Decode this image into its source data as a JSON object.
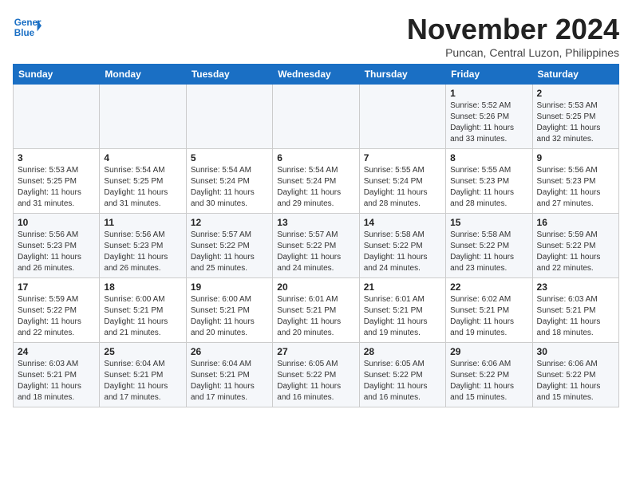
{
  "header": {
    "logo_general": "General",
    "logo_blue": "Blue",
    "month": "November 2024",
    "location": "Puncan, Central Luzon, Philippines"
  },
  "weekdays": [
    "Sunday",
    "Monday",
    "Tuesday",
    "Wednesday",
    "Thursday",
    "Friday",
    "Saturday"
  ],
  "weeks": [
    [
      {
        "day": "",
        "sunrise": "",
        "sunset": "",
        "daylight": ""
      },
      {
        "day": "",
        "sunrise": "",
        "sunset": "",
        "daylight": ""
      },
      {
        "day": "",
        "sunrise": "",
        "sunset": "",
        "daylight": ""
      },
      {
        "day": "",
        "sunrise": "",
        "sunset": "",
        "daylight": ""
      },
      {
        "day": "",
        "sunrise": "",
        "sunset": "",
        "daylight": ""
      },
      {
        "day": "1",
        "sunrise": "Sunrise: 5:52 AM",
        "sunset": "Sunset: 5:26 PM",
        "daylight": "Daylight: 11 hours and 33 minutes."
      },
      {
        "day": "2",
        "sunrise": "Sunrise: 5:53 AM",
        "sunset": "Sunset: 5:25 PM",
        "daylight": "Daylight: 11 hours and 32 minutes."
      }
    ],
    [
      {
        "day": "3",
        "sunrise": "Sunrise: 5:53 AM",
        "sunset": "Sunset: 5:25 PM",
        "daylight": "Daylight: 11 hours and 31 minutes."
      },
      {
        "day": "4",
        "sunrise": "Sunrise: 5:54 AM",
        "sunset": "Sunset: 5:25 PM",
        "daylight": "Daylight: 11 hours and 31 minutes."
      },
      {
        "day": "5",
        "sunrise": "Sunrise: 5:54 AM",
        "sunset": "Sunset: 5:24 PM",
        "daylight": "Daylight: 11 hours and 30 minutes."
      },
      {
        "day": "6",
        "sunrise": "Sunrise: 5:54 AM",
        "sunset": "Sunset: 5:24 PM",
        "daylight": "Daylight: 11 hours and 29 minutes."
      },
      {
        "day": "7",
        "sunrise": "Sunrise: 5:55 AM",
        "sunset": "Sunset: 5:24 PM",
        "daylight": "Daylight: 11 hours and 28 minutes."
      },
      {
        "day": "8",
        "sunrise": "Sunrise: 5:55 AM",
        "sunset": "Sunset: 5:23 PM",
        "daylight": "Daylight: 11 hours and 28 minutes."
      },
      {
        "day": "9",
        "sunrise": "Sunrise: 5:56 AM",
        "sunset": "Sunset: 5:23 PM",
        "daylight": "Daylight: 11 hours and 27 minutes."
      }
    ],
    [
      {
        "day": "10",
        "sunrise": "Sunrise: 5:56 AM",
        "sunset": "Sunset: 5:23 PM",
        "daylight": "Daylight: 11 hours and 26 minutes."
      },
      {
        "day": "11",
        "sunrise": "Sunrise: 5:56 AM",
        "sunset": "Sunset: 5:23 PM",
        "daylight": "Daylight: 11 hours and 26 minutes."
      },
      {
        "day": "12",
        "sunrise": "Sunrise: 5:57 AM",
        "sunset": "Sunset: 5:22 PM",
        "daylight": "Daylight: 11 hours and 25 minutes."
      },
      {
        "day": "13",
        "sunrise": "Sunrise: 5:57 AM",
        "sunset": "Sunset: 5:22 PM",
        "daylight": "Daylight: 11 hours and 24 minutes."
      },
      {
        "day": "14",
        "sunrise": "Sunrise: 5:58 AM",
        "sunset": "Sunset: 5:22 PM",
        "daylight": "Daylight: 11 hours and 24 minutes."
      },
      {
        "day": "15",
        "sunrise": "Sunrise: 5:58 AM",
        "sunset": "Sunset: 5:22 PM",
        "daylight": "Daylight: 11 hours and 23 minutes."
      },
      {
        "day": "16",
        "sunrise": "Sunrise: 5:59 AM",
        "sunset": "Sunset: 5:22 PM",
        "daylight": "Daylight: 11 hours and 22 minutes."
      }
    ],
    [
      {
        "day": "17",
        "sunrise": "Sunrise: 5:59 AM",
        "sunset": "Sunset: 5:22 PM",
        "daylight": "Daylight: 11 hours and 22 minutes."
      },
      {
        "day": "18",
        "sunrise": "Sunrise: 6:00 AM",
        "sunset": "Sunset: 5:21 PM",
        "daylight": "Daylight: 11 hours and 21 minutes."
      },
      {
        "day": "19",
        "sunrise": "Sunrise: 6:00 AM",
        "sunset": "Sunset: 5:21 PM",
        "daylight": "Daylight: 11 hours and 20 minutes."
      },
      {
        "day": "20",
        "sunrise": "Sunrise: 6:01 AM",
        "sunset": "Sunset: 5:21 PM",
        "daylight": "Daylight: 11 hours and 20 minutes."
      },
      {
        "day": "21",
        "sunrise": "Sunrise: 6:01 AM",
        "sunset": "Sunset: 5:21 PM",
        "daylight": "Daylight: 11 hours and 19 minutes."
      },
      {
        "day": "22",
        "sunrise": "Sunrise: 6:02 AM",
        "sunset": "Sunset: 5:21 PM",
        "daylight": "Daylight: 11 hours and 19 minutes."
      },
      {
        "day": "23",
        "sunrise": "Sunrise: 6:03 AM",
        "sunset": "Sunset: 5:21 PM",
        "daylight": "Daylight: 11 hours and 18 minutes."
      }
    ],
    [
      {
        "day": "24",
        "sunrise": "Sunrise: 6:03 AM",
        "sunset": "Sunset: 5:21 PM",
        "daylight": "Daylight: 11 hours and 18 minutes."
      },
      {
        "day": "25",
        "sunrise": "Sunrise: 6:04 AM",
        "sunset": "Sunset: 5:21 PM",
        "daylight": "Daylight: 11 hours and 17 minutes."
      },
      {
        "day": "26",
        "sunrise": "Sunrise: 6:04 AM",
        "sunset": "Sunset: 5:21 PM",
        "daylight": "Daylight: 11 hours and 17 minutes."
      },
      {
        "day": "27",
        "sunrise": "Sunrise: 6:05 AM",
        "sunset": "Sunset: 5:22 PM",
        "daylight": "Daylight: 11 hours and 16 minutes."
      },
      {
        "day": "28",
        "sunrise": "Sunrise: 6:05 AM",
        "sunset": "Sunset: 5:22 PM",
        "daylight": "Daylight: 11 hours and 16 minutes."
      },
      {
        "day": "29",
        "sunrise": "Sunrise: 6:06 AM",
        "sunset": "Sunset: 5:22 PM",
        "daylight": "Daylight: 11 hours and 15 minutes."
      },
      {
        "day": "30",
        "sunrise": "Sunrise: 6:06 AM",
        "sunset": "Sunset: 5:22 PM",
        "daylight": "Daylight: 11 hours and 15 minutes."
      }
    ]
  ]
}
